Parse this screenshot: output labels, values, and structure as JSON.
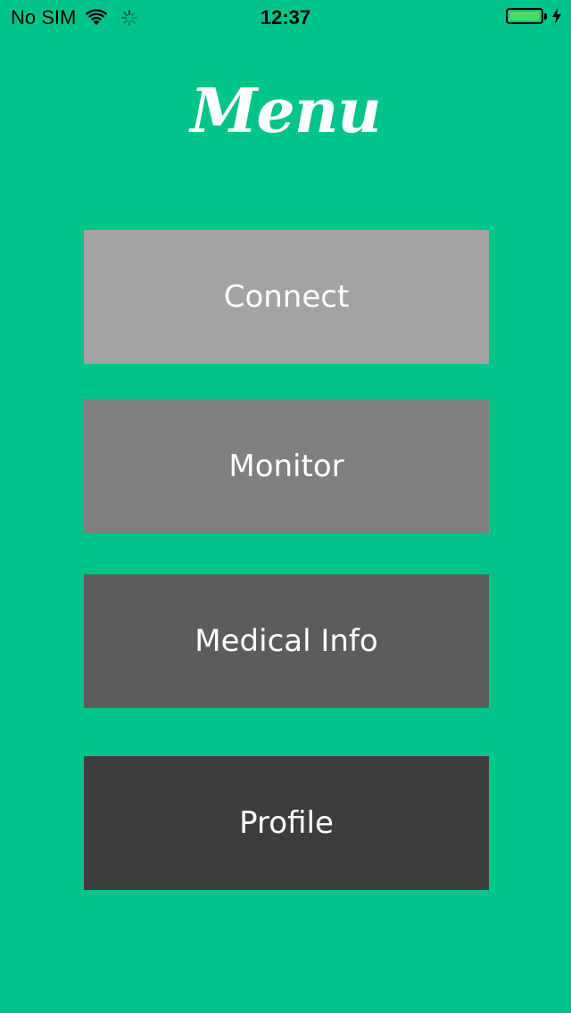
{
  "status_bar": {
    "carrier": "No SIM",
    "time": "12:37",
    "battery_level": 1.0,
    "icons": [
      "wifi-icon",
      "activity-spinner-icon",
      "battery-icon",
      "charging-bolt-icon"
    ]
  },
  "header": {
    "title": "Menu"
  },
  "menu": {
    "items": [
      {
        "label": "Connect",
        "color": "#a3a3a3"
      },
      {
        "label": "Monitor",
        "color": "#808080"
      },
      {
        "label": "Medical Info",
        "color": "#5c5c5c"
      },
      {
        "label": "Profile",
        "color": "#3d3d3d"
      }
    ]
  },
  "colors": {
    "background": "#00c48a",
    "battery_fill": "#4cd964"
  }
}
